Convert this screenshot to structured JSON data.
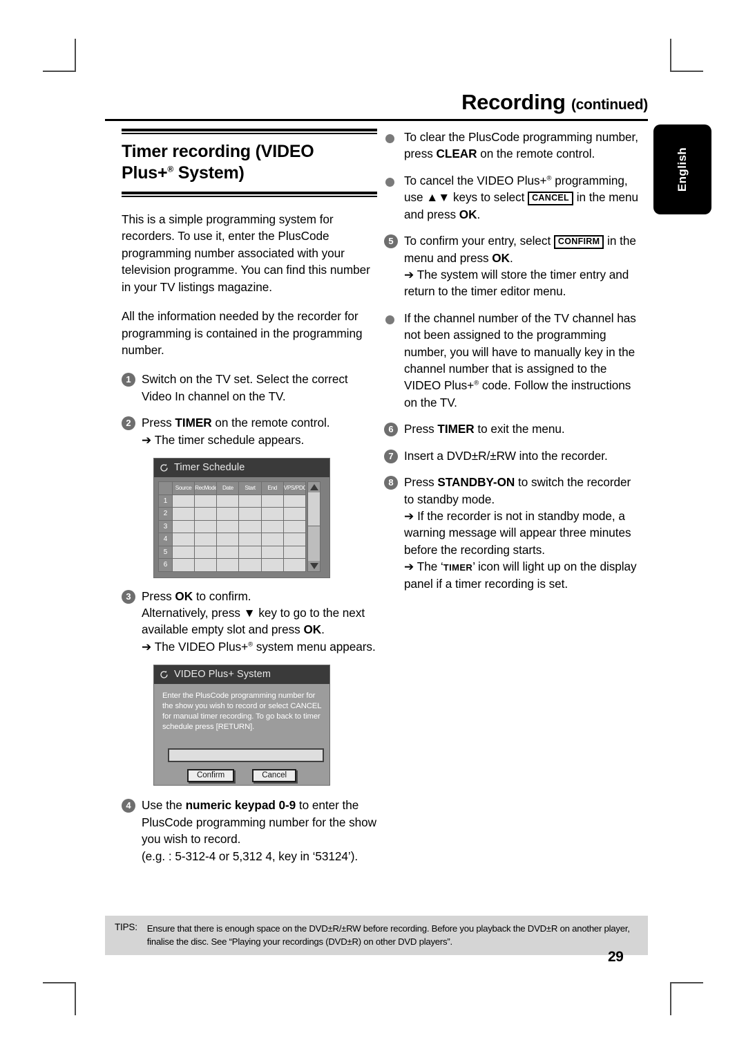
{
  "header": {
    "title": "Recording",
    "continued": "(continued)"
  },
  "language_tab": {
    "label": "English"
  },
  "left_column": {
    "section_title_line1": "Timer recording (VIDEO",
    "section_title_line2_pre": "Plus+",
    "section_title_line2_sup": "®",
    "section_title_line2_post": " System)",
    "intro_paragraph_1": "This is a simple programming system for recorders. To use it, enter the PlusCode programming number associated with your television programme. You can find this number in your TV listings magazine.",
    "intro_paragraph_2": "All the information needed by the recorder for programming is contained in the programming number.",
    "steps": [
      {
        "number": "1",
        "text": "Switch on the TV set. Select the correct Video In channel on the TV."
      },
      {
        "number": "2",
        "text_pre": "Press ",
        "bold": "TIMER",
        "text_post": " on the remote control.",
        "sub": "➔  The timer schedule appears."
      },
      {
        "number": "3",
        "text_pre": "Press ",
        "bold": "OK",
        "text_post": " to confirm.",
        "line2_pre": "Alternatively, press ",
        "line2_glyph": "▼",
        "line2_mid": " key to go to the next available empty slot and press ",
        "line2_bold": "OK",
        "line2_post": ".",
        "sub_pre": "➔ The VIDEO Plus+",
        "sub_sup": "®",
        "sub_post": " system menu appears."
      },
      {
        "number": "4",
        "text_pre": "Use the ",
        "bold": "numeric keypad 0-9",
        "text_post": " to enter the PlusCode programming number for the show you wish to record.",
        "example": "(e.g. : 5-312-4 or 5,312 4, key in ‘53124’)."
      }
    ],
    "timer_schedule_screen": {
      "icon": "refresh-circle-icon",
      "title": "Timer Schedule",
      "columns": [
        "Source",
        "RecMode",
        "Date",
        "Start",
        "End",
        "VPS/PDC"
      ],
      "rows": [
        "1",
        "2",
        "3",
        "4",
        "5",
        "6"
      ],
      "scrollbar": {
        "up": "scroll-up-arrow",
        "down": "scroll-down-arrow"
      }
    },
    "video_plus_screen": {
      "icon": "refresh-circle-icon",
      "title": "VIDEO Plus+ System",
      "message": "Enter the PlusCode programming number for the show you wish to record or select CANCEL for manual timer recording. To go back to timer schedule press [RETURN].",
      "input_value": "",
      "confirm_label": "Confirm",
      "cancel_label": "Cancel"
    }
  },
  "right_column": {
    "bullets_top": [
      {
        "text_pre": "To clear the PlusCode programming number, press ",
        "bold": "CLEAR",
        "text_post": " on the remote control."
      },
      {
        "text_pre": "To cancel the VIDEO Plus+",
        "sup": "®",
        "text_mid": " programming, use ",
        "glyphs": "▲▼",
        "text_mid2": " keys to select ",
        "keybox": "CANCEL",
        "text_mid3": " in the menu and press ",
        "bold": "OK",
        "text_post": "."
      }
    ],
    "steps": [
      {
        "number": "5",
        "text_pre": "To confirm your entry, select ",
        "keybox": "CONFIRM",
        "text_mid": " in the menu and press ",
        "bold": "OK",
        "text_post": ".",
        "sub": "➔ The system will store the timer entry and return to the timer editor menu."
      }
    ],
    "bullets_mid": [
      {
        "text_pre": "If the channel number of the TV channel has not been assigned to the programming number, you will have to manually key in the channel number that is assigned to the VIDEO Plus+",
        "sup": "®",
        "text_post": " code. Follow the instructions on the TV."
      }
    ],
    "steps_bottom": [
      {
        "number": "6",
        "text_pre": "Press ",
        "bold": "TIMER",
        "text_post": " to exit the menu."
      },
      {
        "number": "7",
        "text": "Insert a DVD±R/±RW into the recorder."
      },
      {
        "number": "8",
        "text_pre": "Press ",
        "bold": "STANDBY-ON",
        "text_post": " to switch the recorder to standby mode.",
        "sub1": "➔ If the recorder is not in standby mode, a warning message will appear three minutes before the recording starts.",
        "sub2_pre": "➔ The ‘",
        "sub2_caps": "TIMER",
        "sub2_post": "’ icon will light up on the display panel if a timer recording is set."
      }
    ]
  },
  "footer": {
    "tips_label": "TIPS:",
    "tips_text": "Ensure that there is enough space on the DVD±R/±RW before recording. Before you playback the DVD±R on another player, finalise the disc. See “Playing your recordings (DVD±R) on other DVD players”.",
    "page_number": "29"
  }
}
